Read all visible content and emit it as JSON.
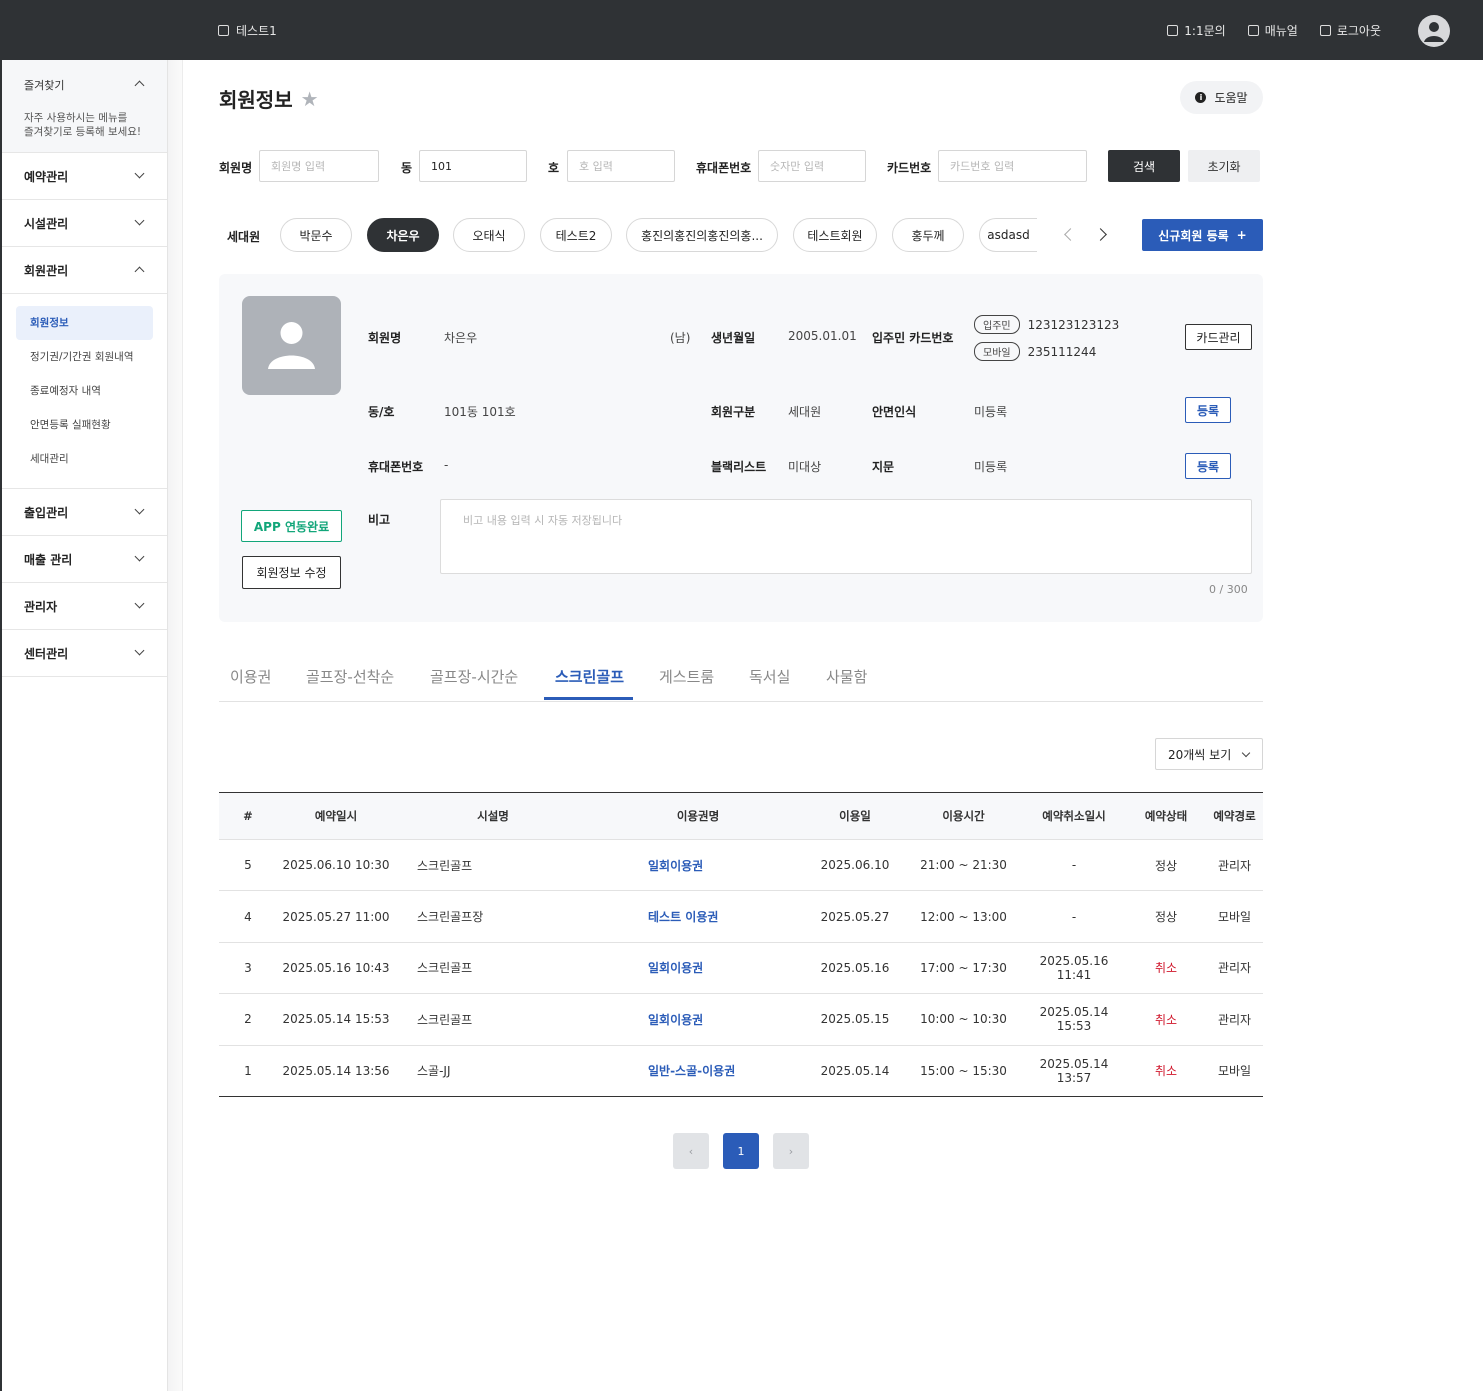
{
  "topbar": {
    "site_name": "테스트1",
    "inquiry": "1:1문의",
    "manual": "매뉴얼",
    "logout": "로그아웃"
  },
  "sidebar": {
    "favorites": {
      "title": "즐겨찾기",
      "desc_line1": "자주 사용하시는 메뉴를",
      "desc_line2": "즐겨찾기로 등록해 보세요!"
    },
    "menus": {
      "reservation": "예약관리",
      "facility": "시설관리",
      "member": "회원관리",
      "access": "출입관리",
      "sales": "매출 관리",
      "admin": "관리자",
      "center": "센터관리"
    },
    "member_sub": [
      "회원정보",
      "정기권/기간권 회원내역",
      "종료예정자 내역",
      "안면등록 실패현황",
      "세대관리"
    ]
  },
  "page": {
    "title": "회원정보",
    "help": "도움말"
  },
  "search": {
    "name_label": "회원명",
    "name_placeholder": "회원명 입력",
    "dong_label": "동",
    "dong_value": "101",
    "ho_label": "호",
    "ho_placeholder": "호 입력",
    "phone_label": "휴대폰번호",
    "phone_placeholder": "숫자만 입력",
    "card_label": "카드번호",
    "card_placeholder": "카드번호 입력",
    "search_btn": "검색",
    "reset_btn": "초기화"
  },
  "household": {
    "label": "세대원",
    "members": [
      "박문수",
      "차은우",
      "오태식",
      "테스트2",
      "홍진의홍진의홍진의홍...",
      "테스트회원",
      "홍두께",
      "asdasd"
    ],
    "active_index": 1,
    "new_member_btn": "신규회원 등록",
    "plus": "+"
  },
  "member": {
    "name_label": "회원명",
    "name": "차은우",
    "gender": "(남)",
    "birth_label": "생년월일",
    "birth": "2005.01.01",
    "card_label": "입주민 카드번호",
    "card_tag1": "입주민",
    "card_no1": "123123123123",
    "card_tag2": "모바일",
    "card_no2": "235111244",
    "card_manage_btn": "카드관리",
    "dongho_label": "동/호",
    "dongho": "101동 101호",
    "type_label": "회원구분",
    "type": "세대원",
    "face_label": "안면인식",
    "face": "미등록",
    "register_btn": "등록",
    "phone_label": "휴대폰번호",
    "phone": "-",
    "blacklist_label": "블랙리스트",
    "blacklist": "미대상",
    "finger_label": "지문",
    "finger": "미등록",
    "app_btn": "APP 연동완료",
    "edit_btn": "회원정보 수정",
    "memo_label": "비고",
    "memo_placeholder": "비고 내용 입력 시 자동 저장됩니다",
    "memo_counter": "0 / 300"
  },
  "tabs": [
    "이용권",
    "골프장-선착순",
    "골프장-시간순",
    "스크린골프",
    "게스트룸",
    "독서실",
    "사물함"
  ],
  "active_tab": 3,
  "page_size": "20개씩 보기",
  "table": {
    "headers": [
      "#",
      "예약일시",
      "시설명",
      "이용권명",
      "이용일",
      "이용시간",
      "예약취소일시",
      "예약상태",
      "예약경로"
    ],
    "rows": [
      [
        "5",
        "2025.06.10 10:30",
        "스크린골프",
        "일회이용권",
        "2025.06.10",
        "21:00 ~ 21:30",
        "-",
        "정상",
        "관리자"
      ],
      [
        "4",
        "2025.05.27 11:00",
        "스크린골프장",
        "테스트 이용권",
        "2025.05.27",
        "12:00 ~ 13:00",
        "-",
        "정상",
        "모바일"
      ],
      [
        "3",
        "2025.05.16 10:43",
        "스크린골프",
        "일회이용권",
        "2025.05.16",
        "17:00 ~ 17:30",
        "2025.05.16 11:41",
        "취소",
        "관리자"
      ],
      [
        "2",
        "2025.05.14 15:53",
        "스크린골프",
        "일회이용권",
        "2025.05.15",
        "10:00 ~ 10:30",
        "2025.05.14 15:53",
        "취소",
        "관리자"
      ],
      [
        "1",
        "2025.05.14 13:56",
        "스골-JJ",
        "일반-스골-이용권",
        "2025.05.14",
        "15:00 ~ 15:30",
        "2025.05.14 13:57",
        "취소",
        "모바일"
      ]
    ]
  },
  "pagination": {
    "prev": "‹",
    "current": "1",
    "next": "›"
  },
  "colors": {
    "topbar": "#2f3235",
    "accent": "#2b5cb8",
    "app_green": "#12a67a",
    "cancel_red": "#d0182d"
  }
}
